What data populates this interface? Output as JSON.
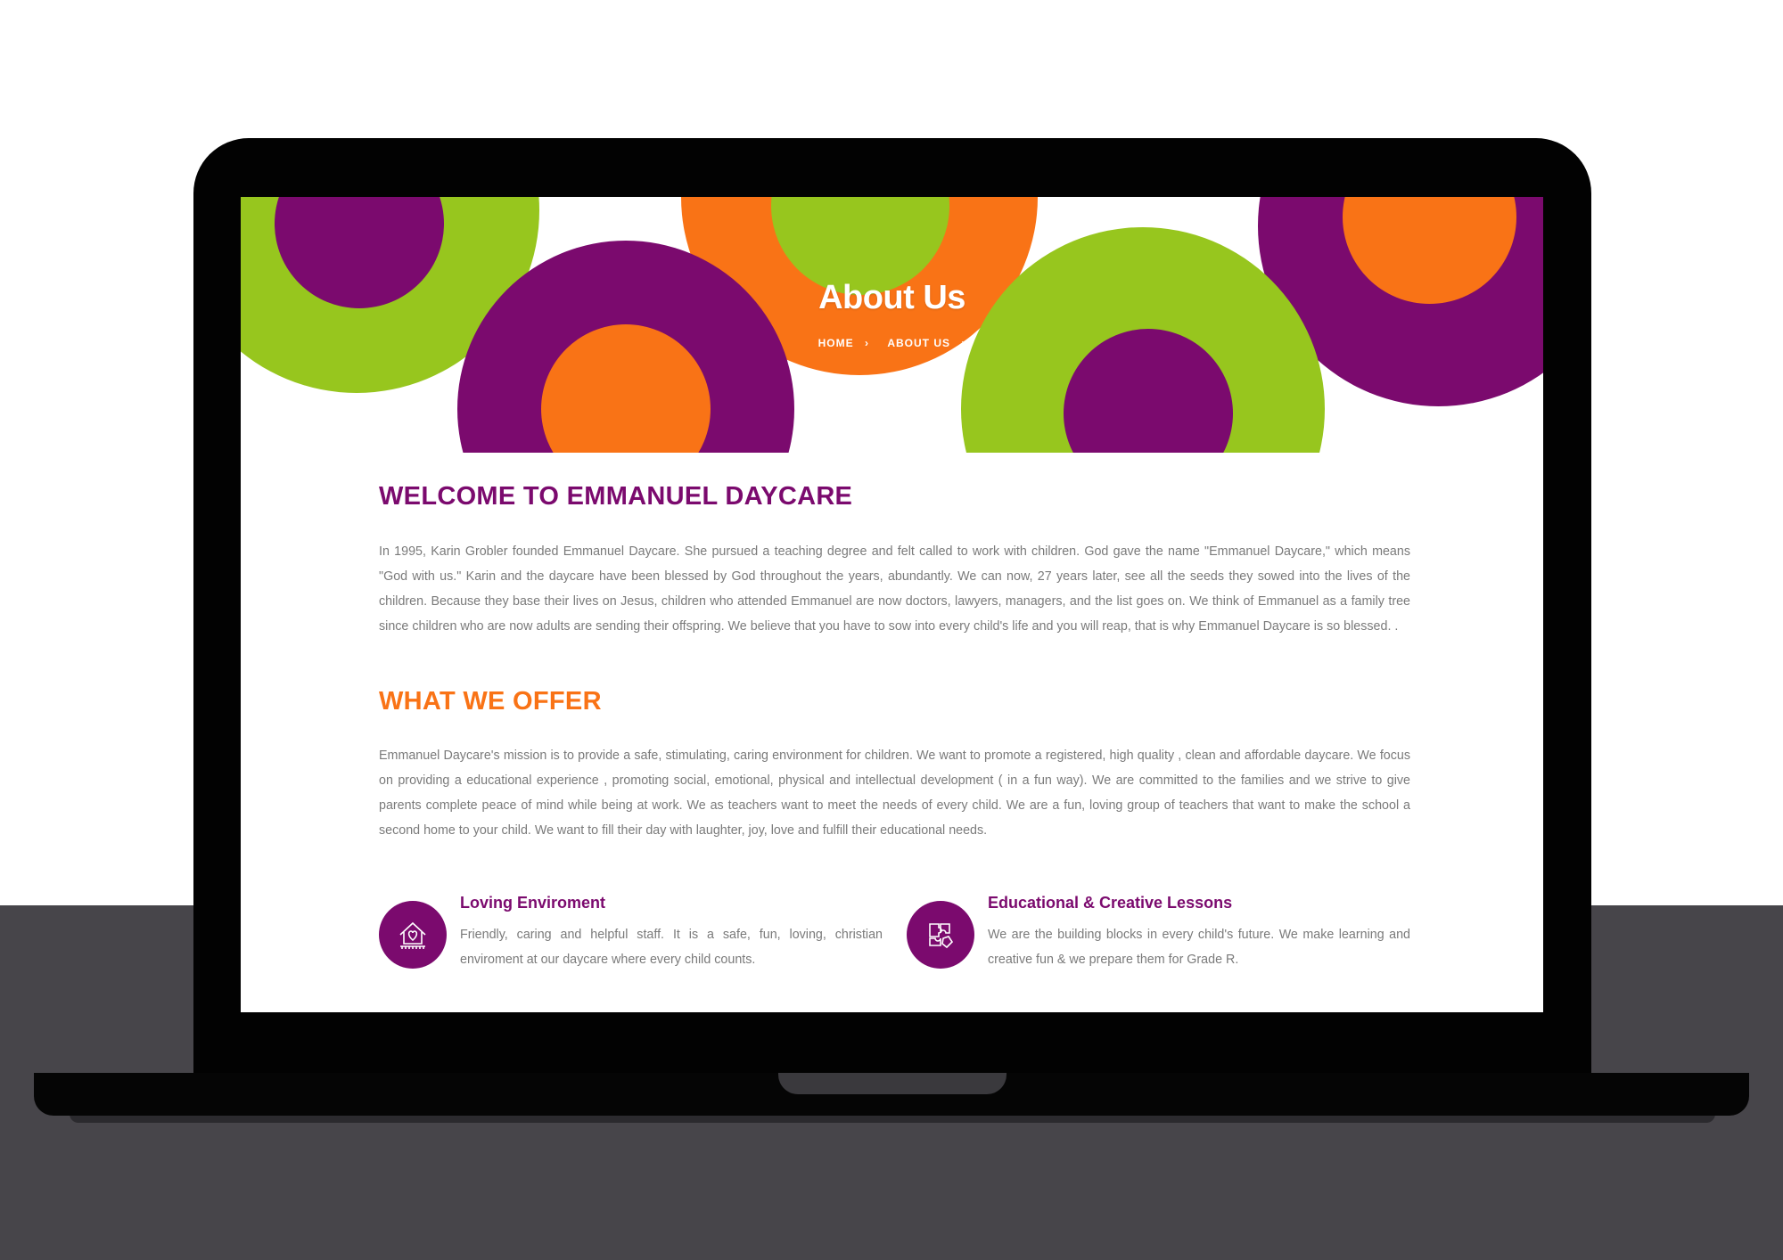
{
  "colors": {
    "purple": "#7b0a6e",
    "orange": "#f97316",
    "green": "#97c61e",
    "floor": "#47454a",
    "body_text": "#7a7a7a"
  },
  "hero": {
    "title": "About Us",
    "breadcrumb": [
      {
        "label": "HOME",
        "icon": "chevron-right-icon"
      },
      {
        "label": "ABOUT US",
        "icon": "chevron-right-icon"
      }
    ]
  },
  "welcome": {
    "title": "WELCOME TO EMMANUEL DAYCARE",
    "text": "In 1995, Karin Grobler founded Emmanuel Daycare. She pursued a teaching degree and felt called to work with children. God gave the name \"Emmanuel Daycare,\" which means \"God with us.\" Karin and the daycare have been blessed by God throughout the years, abundantly. We can now, 27 years later, see all the seeds they sowed into the lives of the children. Because they base their lives on Jesus, children who attended Emmanuel are now doctors, lawyers, managers, and the list goes on. We think of Emmanuel as a family tree since children who are now adults are sending their offspring. We believe that you have to sow into every child's life and you will reap, that is why Emmanuel Daycare is so blessed. ."
  },
  "offer": {
    "title": "WHAT WE OFFER",
    "text": "Emmanuel Daycare's mission is to provide a safe, stimulating, caring environment for children. We want to promote a registered, high quality , clean and affordable daycare. We focus on providing a educational experience , promoting social, emotional, physical and intellectual development ( in a fun way). We are committed to the families and we strive to give parents complete peace of mind while being at work. We as teachers want to meet the needs of every child. We are a fun, loving group of teachers that want to make the school a second home to your child. We want to fill their day with laughter, joy, love and fulfill their educational needs."
  },
  "features": [
    {
      "icon": "house-heart-icon",
      "title": "Loving Enviroment",
      "text": "Friendly, caring and helpful staff. It is a safe, fun, loving, christian enviroment at our daycare where every child counts."
    },
    {
      "icon": "puzzle-pieces-icon",
      "title": "Educational & Creative Lessons",
      "text": "We are the building blocks in every child's future. We make learning and creative fun & we prepare them for Grade R."
    }
  ]
}
